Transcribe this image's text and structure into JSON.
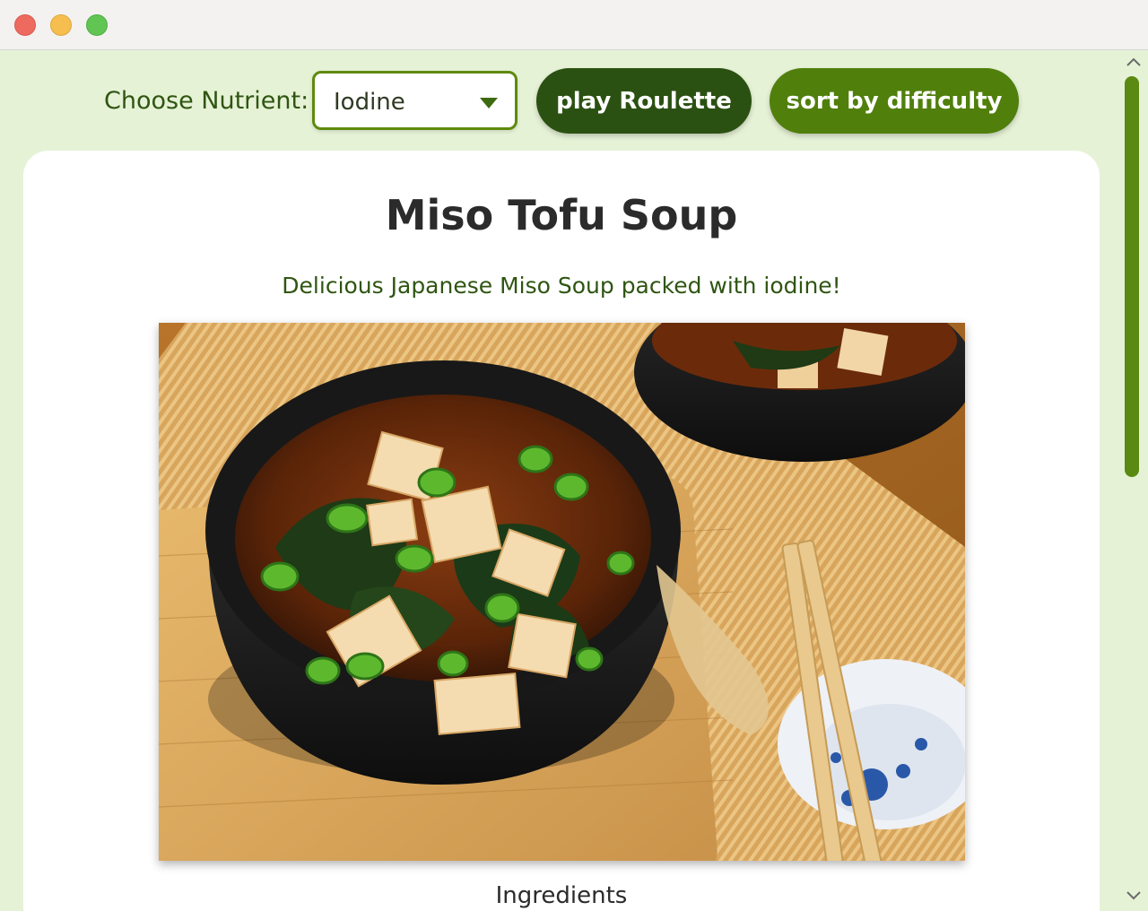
{
  "window": {
    "controls": [
      "close",
      "minimize",
      "maximize"
    ]
  },
  "toolbar": {
    "nutrient_label": "Choose Nutrient:",
    "nutrient_selected": "Iodine",
    "roulette_label": "play Roulette",
    "sort_label": "sort by difficulty"
  },
  "recipe": {
    "title": "Miso Tofu Soup",
    "description": "Delicious Japanese Miso Soup packed with iodine!",
    "ingredients_heading": "Ingredients"
  },
  "colors": {
    "background": "#e6f2d6",
    "dark_green": "#2b5112",
    "accent_green": "#507f0c",
    "text_green": "#2f5512"
  }
}
